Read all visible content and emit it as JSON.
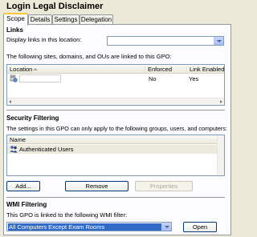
{
  "window": {
    "title": "Login Legal Disclaimer"
  },
  "tabs": [
    {
      "label": "Scope",
      "active": true
    },
    {
      "label": "Details",
      "active": false
    },
    {
      "label": "Settings",
      "active": false
    },
    {
      "label": "Delegation",
      "active": false
    }
  ],
  "links": {
    "section_title": "Links",
    "display_label": "Display links in this location:",
    "display_value": "",
    "linked_text": "The following sites, domains, and OUs are linked to this GPO:",
    "columns": [
      "Location",
      "Enforced",
      "Link Enabled"
    ],
    "rows": [
      {
        "location": "",
        "enforced": "No",
        "link_enabled": "Yes",
        "icon": "domain-icon"
      }
    ]
  },
  "security": {
    "section_title": "Security Filtering",
    "desc": "The settings in this GPO can only apply to the following groups, users, and computers:",
    "columns": [
      "Name"
    ],
    "rows": [
      {
        "name": "Authenticated Users",
        "icon": "users-group-icon"
      }
    ],
    "buttons": {
      "add": "Add...",
      "remove": "Remove",
      "properties": "Properties"
    }
  },
  "wmi": {
    "section_title": "WMI Filtering",
    "desc": "This GPO is linked to the following WMI filter:",
    "selected": "All Computers Except Exam Rooms",
    "open_label": "Open"
  },
  "colors": {
    "accent": "#316ac5",
    "tab_highlight": "#ffc83c",
    "border": "#919b9c"
  }
}
